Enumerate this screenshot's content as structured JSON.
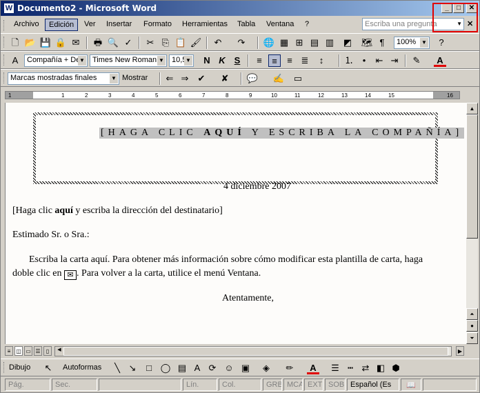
{
  "window": {
    "title": "Documento2 - Microsoft Word",
    "app_icon_label": "W"
  },
  "caption": {
    "minimize": "_",
    "maximize": "□",
    "close": "✕"
  },
  "menubar": {
    "items": [
      "Archivo",
      "Edición",
      "Ver",
      "Insertar",
      "Formato",
      "Herramientas",
      "Tabla",
      "Ventana",
      "?"
    ],
    "active_index": 1,
    "help_placeholder": "Escriba una pregunta",
    "doc_close": "✕"
  },
  "formatting": {
    "style": "Compañía + De",
    "font": "Times New Roman",
    "size": "10,5",
    "bold": "N",
    "italic": "K",
    "strike": "S",
    "zoom": "100%"
  },
  "review": {
    "display": "Marcas mostradas finales",
    "show_label": "Mostrar"
  },
  "ruler": {
    "numbers": [
      "1",
      "1",
      "2",
      "3",
      "4",
      "5",
      "6",
      "7",
      "8",
      "9",
      "10",
      "11",
      "12",
      "13",
      "14",
      "15",
      "16"
    ]
  },
  "document": {
    "company_line": "[HAGA CLIC ",
    "company_bold": "AQUÍ",
    "company_rest": " Y ESCRIBA LA COMPAÑÍA]",
    "date": "4 diciembre 2007",
    "recipient_pre": "[Haga clic ",
    "recipient_bold": "aquí",
    "recipient_post": " y escriba la dirección del destinatario]",
    "greeting": "Estimado Sr. o Sra.:",
    "body_line1": "Escriba la carta aquí. Para obtener más información sobre cómo modificar esta plantilla de carta, haga",
    "body_line2_pre": "doble clic en",
    "body_line2_post": ". Para volver a la carta, utilice el menú Ventana.",
    "closing": "Atentamente,"
  },
  "drawing": {
    "draw_label": "Dibujo",
    "autoshapes_label": "Autoformas"
  },
  "status": {
    "page": "Pág.",
    "section": "Sec.",
    "line": "Lín.",
    "column": "Col.",
    "rec": "GRB",
    "track": "MCA",
    "ext": "EXT",
    "ovr": "SOB",
    "language": "Español (Es"
  }
}
